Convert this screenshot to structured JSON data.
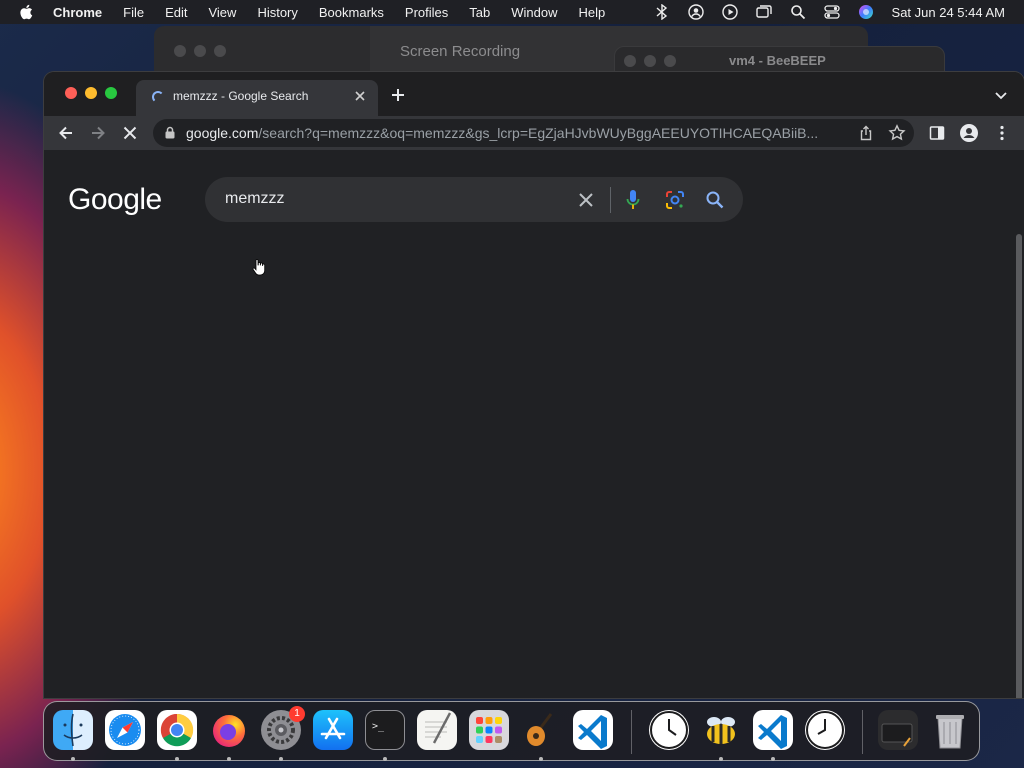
{
  "menubar": {
    "app_name": "Chrome",
    "items": [
      "File",
      "Edit",
      "View",
      "History",
      "Bookmarks",
      "Profiles",
      "Tab",
      "Window",
      "Help"
    ],
    "status_icons": [
      "bluetooth-icon",
      "user-account-icon",
      "play-icon",
      "screens-icon",
      "spotlight-search-icon",
      "control-center-icon",
      "siri-icon"
    ],
    "clock": "Sat Jun 24  5:44 AM"
  },
  "background_windows": {
    "screen_recording_title": "Screen Recording",
    "beebeep_title": "vm4 - BeeBEEP"
  },
  "browser": {
    "tab": {
      "title": "memzzz - Google Search",
      "loading": true
    },
    "omnibox": {
      "host": "google.com",
      "path": "/search?q=memzzz&oq=memzzz&gs_lcrp=EgZjaHJvbWUyBggAEEUYOTIHCAEQABiiB..."
    },
    "page": {
      "logo": "Google",
      "search_query": "memzzz"
    }
  },
  "dock": {
    "apps": [
      "Finder",
      "Safari",
      "Google Chrome",
      "Firefox",
      "System Settings",
      "App Store",
      "Terminal",
      "TextEdit",
      "Launchpad",
      "GarageBand",
      "Visual Studio Code"
    ],
    "system_settings_badge": "1",
    "recent_apps": [
      "Clock",
      "BeeBEEP",
      "Visual Studio Code",
      "Clock"
    ],
    "trash": "Trash"
  },
  "colors": {
    "accent": "#8ab4f8",
    "page_bg": "#202124",
    "searchbox_bg": "#303134",
    "toolbar_bg": "#35363a"
  }
}
